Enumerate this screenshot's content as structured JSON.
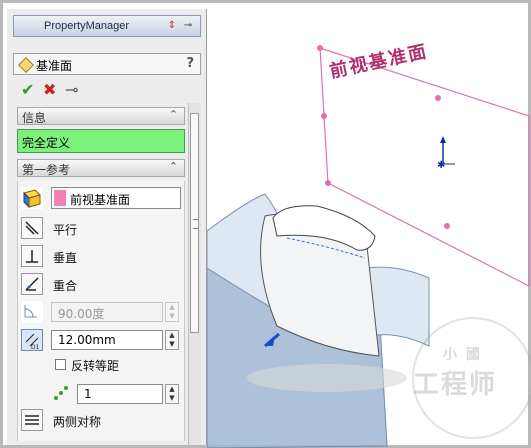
{
  "panel": {
    "title": "PropertyManager",
    "feature_title": "基准面",
    "help": "?",
    "ok_glyph": "✔",
    "cancel_glyph": "✖",
    "pin_glyph": "⊸"
  },
  "info_group": {
    "label": "信息",
    "status": "完全定义",
    "status_color": "#7cf07c"
  },
  "first_ref": {
    "label": "第一参考",
    "reference": "前视基准面",
    "options": {
      "parallel": "平行",
      "perpendicular": "垂直",
      "coincident": "重合",
      "flip_offset": "反转等距",
      "mid_plane": "两侧对称"
    },
    "angle_value": "90.00度",
    "distance_value": "12.00mm",
    "instance_count": "1",
    "distance_icon_label": "D1"
  },
  "view": {
    "plane_label": "前视基准面",
    "plane_color": "#e070b0",
    "watermark": "工程师",
    "watermark_top": "小  國"
  }
}
